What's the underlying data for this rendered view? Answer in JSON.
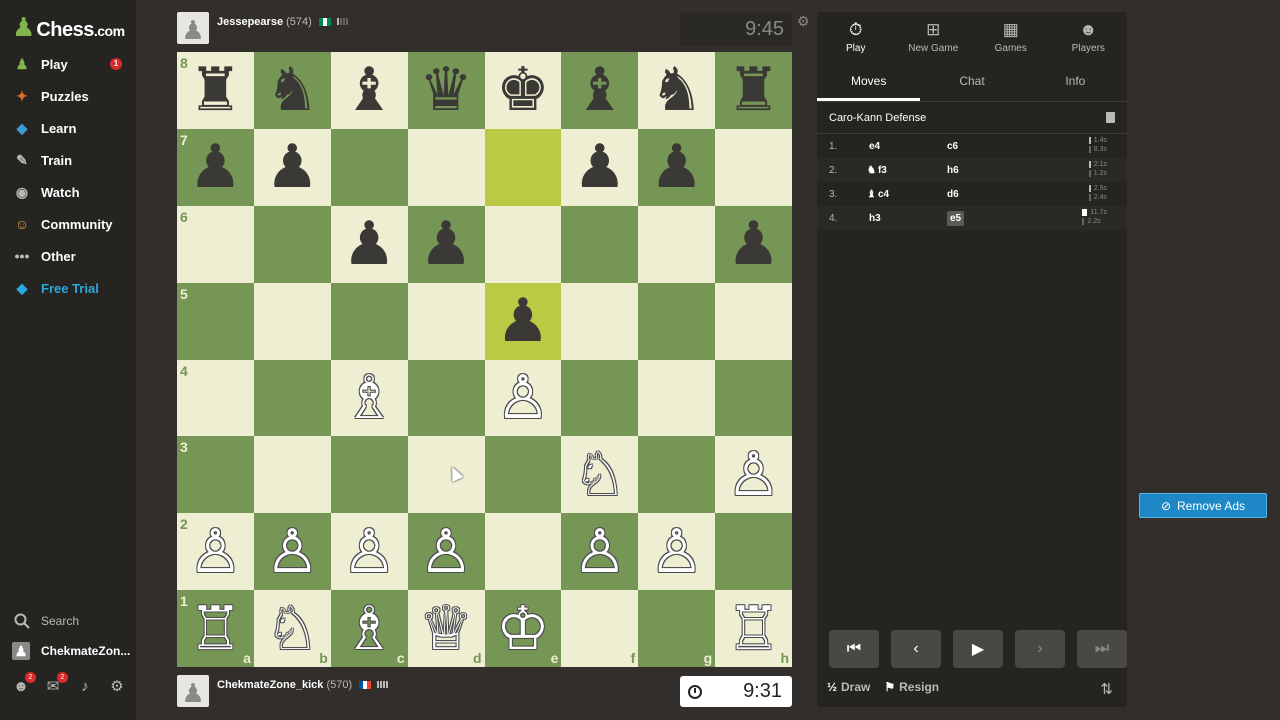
{
  "logo": {
    "main": "Chess",
    "suffix": ".com"
  },
  "nav": [
    {
      "label": "Play",
      "icon": "play-icon",
      "badge": "1"
    },
    {
      "label": "Puzzles",
      "icon": "puzzle-icon"
    },
    {
      "label": "Learn",
      "icon": "learn-icon"
    },
    {
      "label": "Train",
      "icon": "train-icon"
    },
    {
      "label": "Watch",
      "icon": "watch-icon"
    },
    {
      "label": "Community",
      "icon": "community-icon"
    },
    {
      "label": "Other",
      "icon": "more-icon"
    },
    {
      "label": "Free Trial",
      "icon": "diamond-icon",
      "color": "#2ba8e0"
    }
  ],
  "sidebar_bottom": {
    "search": "Search",
    "user": "ChekmateZon...",
    "friends_badge": "2",
    "messages_badge": "2"
  },
  "top_player": {
    "name": "Jessepearse",
    "rating": "(574)",
    "clock": "9:45"
  },
  "bottom_player": {
    "name": "ChekmateZone_kick",
    "rating": "(570)",
    "clock": "9:31"
  },
  "board": {
    "ranks": [
      "8",
      "7",
      "6",
      "5",
      "4",
      "3",
      "2",
      "1"
    ],
    "files": [
      "a",
      "b",
      "c",
      "d",
      "e",
      "f",
      "g",
      "h"
    ],
    "position": [
      [
        "♜",
        "♞",
        "♝",
        "♛",
        "♚",
        "♝",
        "♞",
        "♜"
      ],
      [
        "♟",
        "♟",
        "",
        "",
        "",
        "♟",
        "♟",
        ""
      ],
      [
        "",
        "",
        "♟",
        "♟",
        "",
        "",
        "",
        "♟"
      ],
      [
        "",
        "",
        "",
        "",
        "♟",
        "",
        "",
        ""
      ],
      [
        "",
        "",
        "♗",
        "",
        "♙",
        "",
        "",
        ""
      ],
      [
        "",
        "",
        "",
        "",
        "",
        "♘",
        "",
        "♙"
      ],
      [
        "♙",
        "♙",
        "♙",
        "♙",
        "",
        "♙",
        "♙",
        ""
      ],
      [
        "♖",
        "♘",
        "♗",
        "♕",
        "♔",
        "",
        "",
        "♖"
      ]
    ],
    "colors": [
      [
        "b",
        "b",
        "b",
        "b",
        "b",
        "b",
        "b",
        "b"
      ],
      [
        "b",
        "b",
        "",
        "",
        "",
        "b",
        "b",
        ""
      ],
      [
        "",
        "",
        "b",
        "b",
        "",
        "",
        "",
        "b"
      ],
      [
        "",
        "",
        "",
        "",
        "b",
        "",
        "",
        ""
      ],
      [
        "",
        "",
        "w",
        "",
        "w",
        "",
        "",
        ""
      ],
      [
        "",
        "",
        "",
        "",
        "",
        "w",
        "",
        "w"
      ],
      [
        "w",
        "w",
        "w",
        "w",
        "",
        "w",
        "w",
        ""
      ],
      [
        "w",
        "w",
        "w",
        "w",
        "w",
        "",
        "",
        "w"
      ]
    ],
    "highlight": [
      "e7",
      "e5"
    ],
    "light_color": "#eeeed2",
    "dark_color": "#769656",
    "highlight_color": "#baca44"
  },
  "panel_tabs": [
    {
      "label": "Play",
      "icon": "stopwatch-icon"
    },
    {
      "label": "New Game",
      "icon": "plus-square-icon"
    },
    {
      "label": "Games",
      "icon": "board-icon"
    },
    {
      "label": "Players",
      "icon": "players-icon"
    }
  ],
  "sub_tabs": [
    "Moves",
    "Chat",
    "Info"
  ],
  "opening": "Caro-Kann Defense",
  "moves": [
    {
      "num": "1.",
      "white": "e4",
      "white_fig": "",
      "black": "c6",
      "t1": "1.4s",
      "t2": "8.3s"
    },
    {
      "num": "2.",
      "white": "f3",
      "white_fig": "♞",
      "black": "h6",
      "t1": "2.1s",
      "t2": "1.2s"
    },
    {
      "num": "3.",
      "white": "c4",
      "white_fig": "♝",
      "black": "d6",
      "t1": "2.9s",
      "t2": "2.4s"
    },
    {
      "num": "4.",
      "white": "h3",
      "white_fig": "",
      "black": "e5",
      "t1": "11.7s",
      "t2": "2.2s"
    }
  ],
  "controls": [
    "first-icon",
    "prev-icon",
    "play-icon",
    "next-icon",
    "last-icon"
  ],
  "actions": {
    "draw": "Draw",
    "draw_icon": "½",
    "resign": "Resign"
  },
  "remove_ads": "Remove Ads"
}
